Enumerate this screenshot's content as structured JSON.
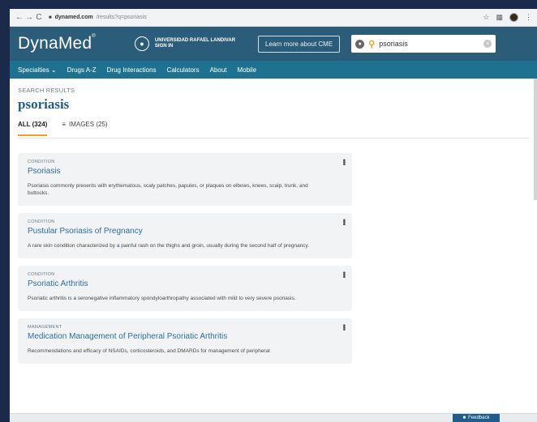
{
  "browser": {
    "back": "←",
    "forward": "→",
    "reload": "C",
    "lock": "🔒",
    "url_domain": "dynamed.com",
    "url_path": "/results?q=psoriasis",
    "star": "☆"
  },
  "header": {
    "logo": "DynaMed",
    "logo_mark": "®",
    "institution": "UNIVERSIDAD RAFAEL LANDIVAR",
    "sign_in": "SIGN IN",
    "cme_button": "Learn more about CME",
    "search_value": "psoriasis"
  },
  "nav": {
    "items": [
      "Specialties ⌄",
      "Drugs A-Z",
      "Drug Interactions",
      "Calculators",
      "About",
      "Mobile"
    ]
  },
  "main": {
    "eyebrow": "SEARCH RESULTS",
    "query": "psoriasis",
    "tabs": [
      {
        "label": "ALL (324)",
        "active": true
      },
      {
        "label": "IMAGES (25)",
        "active": false
      }
    ],
    "results": [
      {
        "type": "CONDITION",
        "title": "Psoriasis",
        "desc": "Psoriasis commonly presents with erythematous, scaly patches, papules, or plaques on elbows, knees, scalp, trunk, and buttocks."
      },
      {
        "type": "CONDITION",
        "title": "Pustular Psoriasis of Pregnancy",
        "desc": "A rare skin condition characterized by a painful rash on the thighs and groin, usually during the second half of pregnancy."
      },
      {
        "type": "CONDITION",
        "title": "Psoriatic Arthritis",
        "desc": "Psoriatic arthritis is a seronegative inflammatory spondyloarthropathy associated with mild to very severe psoriasis."
      },
      {
        "type": "MANAGEMENT",
        "title": "Medication Management of Peripheral Psoriatic Arthritis",
        "desc": "Recommendations and efficacy of NSAIDs, corticosteroids, and DMARDs for management of peripheral"
      }
    ]
  },
  "footer": {
    "feedback": "Feedback"
  },
  "colors": {
    "header_bg": "#2b5d7a",
    "nav_bg": "#1e7290",
    "accent": "#f2a024",
    "link": "#2a6fa6"
  }
}
